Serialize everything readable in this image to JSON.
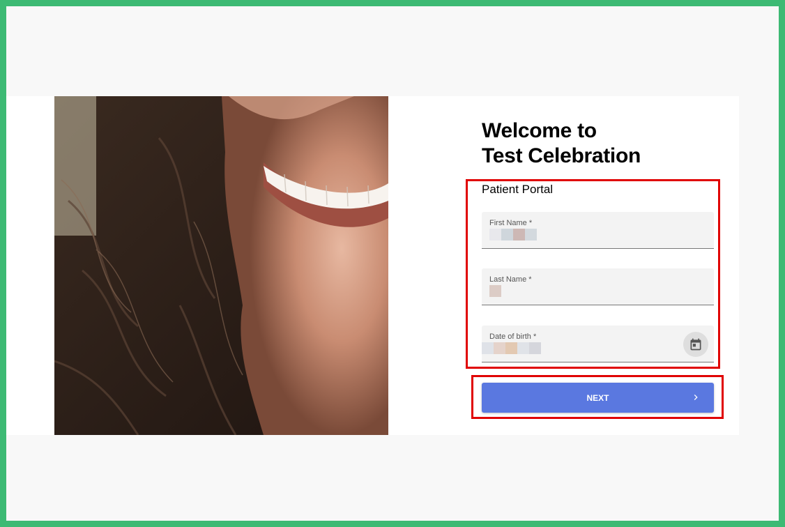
{
  "header": {
    "title_line1": "Welcome to",
    "title_line2": "Test Celebration"
  },
  "form": {
    "subtitle": "Patient Portal",
    "first_name": {
      "label": "First Name *"
    },
    "last_name": {
      "label": "Last Name *"
    },
    "date_of_birth": {
      "label": "Date of birth *"
    },
    "next_label": "NEXT"
  },
  "colors": {
    "frame_border": "#3dba74",
    "primary_button": "#5a78e0",
    "highlight": "#e00000"
  },
  "icons": {
    "calendar": "calendar-icon",
    "next": "chevron-right-icon"
  }
}
